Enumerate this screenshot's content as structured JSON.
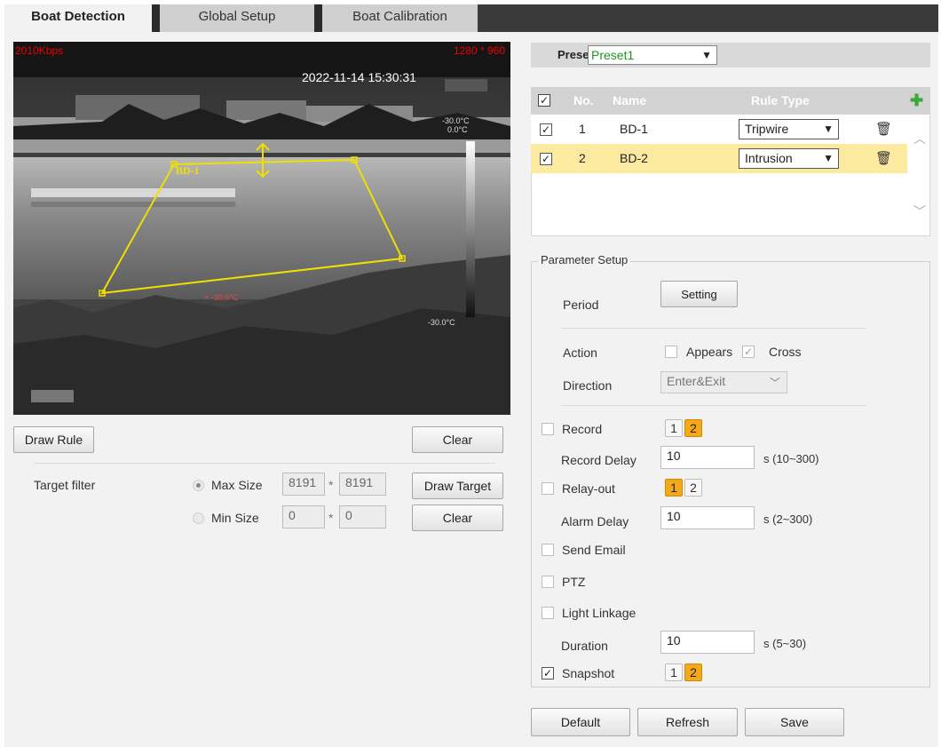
{
  "tabs": [
    {
      "label": "Boat Detection",
      "active": true
    },
    {
      "label": "Global Setup",
      "active": false
    },
    {
      "label": "Boat Calibration",
      "active": false
    }
  ],
  "video": {
    "bitrate": "2010Kbps",
    "resolution": "1280 * 960",
    "timestamp": "2022-11-14 15:30:31",
    "rule_label": "BD-1",
    "temp_top": "-30.0°C",
    "temp_top2": "0.0°C",
    "temp_bottom": "-30.0°C",
    "target_temp": "-30.0°C"
  },
  "left_controls": {
    "draw_rule": "Draw Rule",
    "clear_top": "Clear",
    "target_filter_label": "Target filter",
    "max_size_label": "Max Size",
    "max_w": "8191",
    "max_h": "8191",
    "min_size_label": "Min Size",
    "min_w": "0",
    "min_h": "0",
    "times": "*",
    "draw_target": "Draw Target",
    "clear_bottom": "Clear"
  },
  "preset": {
    "label": "Preset",
    "value": "Preset1"
  },
  "rule_table": {
    "headers": {
      "no": "No.",
      "name": "Name",
      "rule_type": "Rule Type"
    },
    "rows": [
      {
        "no": "1",
        "name": "BD-1",
        "rule_type": "Tripwire",
        "checked": true,
        "selected": false
      },
      {
        "no": "2",
        "name": "BD-2",
        "rule_type": "Intrusion",
        "checked": true,
        "selected": true
      }
    ]
  },
  "params": {
    "legend": "Parameter Setup",
    "period_label": "Period",
    "setting_btn": "Setting",
    "action_label": "Action",
    "appears": "Appears",
    "cross": "Cross",
    "direction_label": "Direction",
    "direction_value": "Enter&Exit",
    "record": "Record",
    "record_delay_label": "Record Delay",
    "record_delay": "10",
    "record_delay_range": "s (10~300)",
    "relay_out": "Relay-out",
    "alarm_delay_label": "Alarm Delay",
    "alarm_delay": "10",
    "alarm_delay_range": "s (2~300)",
    "send_email": "Send Email",
    "ptz": "PTZ",
    "light_linkage": "Light Linkage",
    "duration_label": "Duration",
    "duration": "10",
    "duration_range": "s (5~30)",
    "snapshot": "Snapshot",
    "num1": "1",
    "num2": "2",
    "check_mark": "✓"
  },
  "footer": {
    "default": "Default",
    "refresh": "Refresh",
    "save": "Save"
  },
  "colors": {
    "accent_orange": "#f5a91a",
    "rule_yellow": "#f0e000",
    "osd_red": "#dd0000",
    "selected_row": "#fbeaa0",
    "preset_green": "#1a9a1a"
  }
}
